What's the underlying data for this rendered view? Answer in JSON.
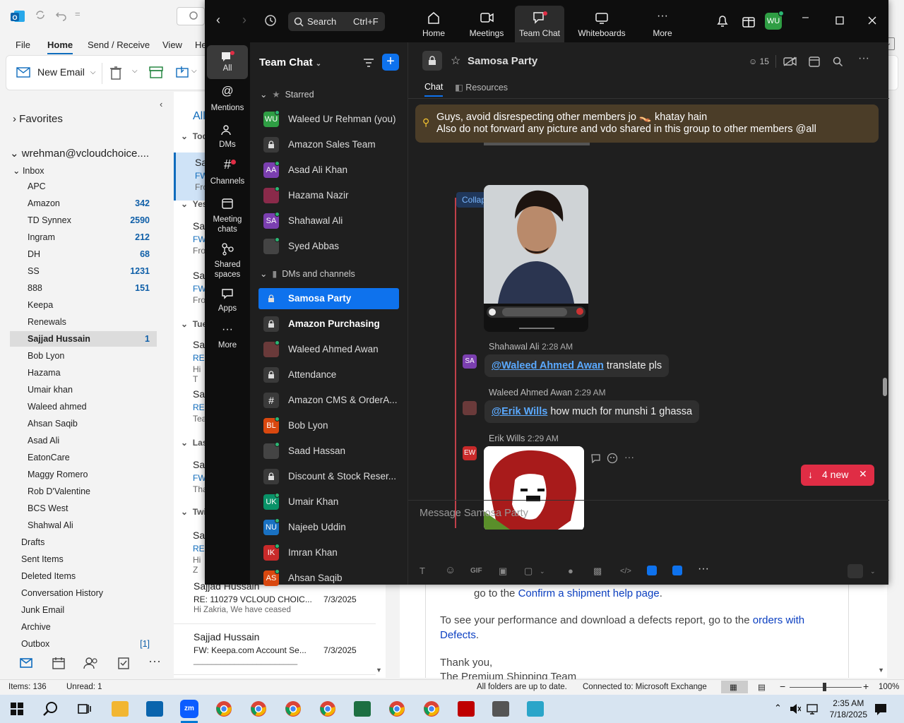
{
  "outlook": {
    "menu": [
      "File",
      "Home",
      "Send / Receive",
      "View",
      "He"
    ],
    "ribbon": {
      "new_email": "New Email"
    },
    "favorites": "Favorites",
    "account": "wrehman@vcloudchoice....",
    "inbox": "Inbox",
    "folders": [
      {
        "name": "APC",
        "count": ""
      },
      {
        "name": "Amazon",
        "count": "342"
      },
      {
        "name": "TD Synnex",
        "count": "2590"
      },
      {
        "name": "Ingram",
        "count": "212"
      },
      {
        "name": "DH",
        "count": "68"
      },
      {
        "name": "SS",
        "count": "1231"
      },
      {
        "name": "888",
        "count": "151"
      },
      {
        "name": "Keepa",
        "count": ""
      },
      {
        "name": "Renewals",
        "count": ""
      },
      {
        "name": "Sajjad Hussain",
        "count": "1"
      },
      {
        "name": "Bob Lyon",
        "count": ""
      },
      {
        "name": "Hazama",
        "count": ""
      },
      {
        "name": "Umair khan",
        "count": ""
      },
      {
        "name": "Waleed ahmed",
        "count": ""
      },
      {
        "name": "Ahsan Saqib",
        "count": ""
      },
      {
        "name": "Asad Ali",
        "count": ""
      },
      {
        "name": "EatonCare",
        "count": ""
      },
      {
        "name": "Maggy Romero",
        "count": ""
      },
      {
        "name": "Rob D'Valentine",
        "count": ""
      },
      {
        "name": "BCS West",
        "count": ""
      },
      {
        "name": "Shahwal Ali",
        "count": ""
      }
    ],
    "top_folders": [
      "Drafts",
      "Sent Items",
      "Deleted Items",
      "Conversation History",
      "Junk Email",
      "Archive",
      "Outbox"
    ],
    "outbox_count": "[1]",
    "list_header": "All",
    "groups": [
      "Tod",
      "Yes",
      "Tue",
      "Las",
      "Twi"
    ],
    "list_items": [
      {
        "from": "Sajjad Hussain",
        "subject": "RE: 110279 VCLOUD CHOIC...",
        "date": "7/3/2025",
        "preview": "Hi Zakria,  We have ceased"
      },
      {
        "from": "Sajjad Hussain",
        "subject": "FW: Keepa.com Account Se...",
        "date": "7/3/2025",
        "preview": "_______________________"
      }
    ],
    "list_fragments": [
      {
        "a": "Sa",
        "b": "FW",
        "c": "Fro"
      },
      {
        "a": "Sa",
        "b": "FW",
        "c": "Fro"
      },
      {
        "a": "Sa",
        "b": "FW",
        "c": "Fro"
      },
      {
        "a": "Sa",
        "b": "RE:",
        "c": "Hi T"
      },
      {
        "a": "Sa",
        "b": "RE:",
        "c": "Tea"
      },
      {
        "a": "Sa",
        "b": "FW",
        "c": "Tha"
      },
      {
        "a": "Sa",
        "b": "RE:",
        "c": "Hi Z"
      }
    ],
    "reading": {
      "line1_prefix": "go to the ",
      "line1_link": "Confirm a shipment help page",
      "line1_suffix": ".",
      "line2_prefix": "To see your performance and download a defects report, go to the ",
      "line2_link": "orders with Defects",
      "line2_suffix": ".",
      "thanks": "Thank you,",
      "team": "The Premium Shipping Team"
    },
    "status": {
      "items": "Items: 136",
      "unread": "Unread: 1",
      "sync": "All folders are up to date.",
      "conn": "Connected to: Microsoft Exchange",
      "zoom": "100%"
    }
  },
  "taskbar": {
    "time": "2:35 AM",
    "date": "7/18/2025",
    "apps": [
      "File Explorer",
      "Outlook",
      "Zoom",
      "Chrome",
      "Chrome",
      "Chrome",
      "Chrome",
      "Excel",
      "Chrome",
      "Chrome",
      "FileZilla",
      "Calculator",
      "App"
    ]
  },
  "zoom": {
    "search": "Search",
    "search_key": "Ctrl+F",
    "tabs": [
      "Home",
      "Meetings",
      "Team Chat",
      "Whiteboards",
      "More"
    ],
    "avatar": "WU",
    "rail": [
      "All",
      "Mentions",
      "DMs",
      "Channels",
      "Meeting chats",
      "Shared spaces",
      "Apps",
      "More"
    ],
    "side_title": "Team Chat",
    "starred_label": "Starred",
    "starred": [
      {
        "name": "Waleed Ur Rehman (you)",
        "av": "WU",
        "color": "#2f9e44"
      },
      {
        "name": "Amazon Sales Team",
        "av": "lock",
        "color": "#3a3a3a"
      },
      {
        "name": "Asad Ali Khan",
        "av": "AA",
        "color": "#7b3fb0"
      },
      {
        "name": "Hazama Nazir",
        "av": "",
        "color": "#8a2a4a"
      },
      {
        "name": "Shahawal Ali",
        "av": "SA",
        "color": "#7b3fb0"
      },
      {
        "name": "Syed Abbas",
        "av": "",
        "color": "#444"
      }
    ],
    "dms_label": "DMs and channels",
    "dms": [
      {
        "name": "Samosa Party",
        "av": "lock",
        "color": "#0e72ed",
        "sel": true
      },
      {
        "name": "Amazon Purchasing",
        "av": "lock",
        "color": "#3a3a3a",
        "bold": true
      },
      {
        "name": "Waleed Ahmed Awan",
        "av": "",
        "color": "#6a3a3a"
      },
      {
        "name": "Attendance",
        "av": "lock",
        "color": "#3a3a3a"
      },
      {
        "name": "Amazon CMS & OrderA...",
        "av": "#",
        "color": "#3a3a3a"
      },
      {
        "name": "Bob Lyon",
        "av": "BL",
        "color": "#d9480f"
      },
      {
        "name": "Saad Hassan",
        "av": "",
        "color": "#444"
      },
      {
        "name": "Discount & Stock Reser...",
        "av": "lock",
        "color": "#3a3a3a"
      },
      {
        "name": "Umair Khan",
        "av": "UK",
        "color": "#099268"
      },
      {
        "name": "Najeeb Uddin",
        "av": "NU",
        "color": "#1971c2"
      },
      {
        "name": "Imran Khan",
        "av": "IK",
        "color": "#c92a2a"
      },
      {
        "name": "Ahsan Saqib",
        "av": "AS",
        "color": "#d9480f"
      }
    ],
    "channel": {
      "name": "Samosa Party",
      "members": "15"
    },
    "ch_tabs": [
      "Chat",
      "Resources"
    ],
    "pinned": {
      "line1": "Guys, avoid disrespecting other members jo 👡 khatay hain",
      "line2": "Also do not forward any picture and vdo shared in this group to other members @all"
    },
    "collapse": "Collapse all",
    "messages": [
      {
        "sender": "Shahawal Ali",
        "time": "2:28 AM",
        "mention": "@Waleed Ahmed Awan",
        "text": " translate pls",
        "av": "SA"
      },
      {
        "sender": "Waleed Ahmed Awan",
        "time": "2:29 AM",
        "mention": "@Erik Wills",
        "text": " how much for munshi 1 ghassa",
        "av": ""
      },
      {
        "sender": "Erik Wills",
        "time": "2:29 AM",
        "av": "EW"
      }
    ],
    "new_count": "4 new",
    "compose_placeholder": "Message Samosa Party",
    "gif": "GIF"
  }
}
